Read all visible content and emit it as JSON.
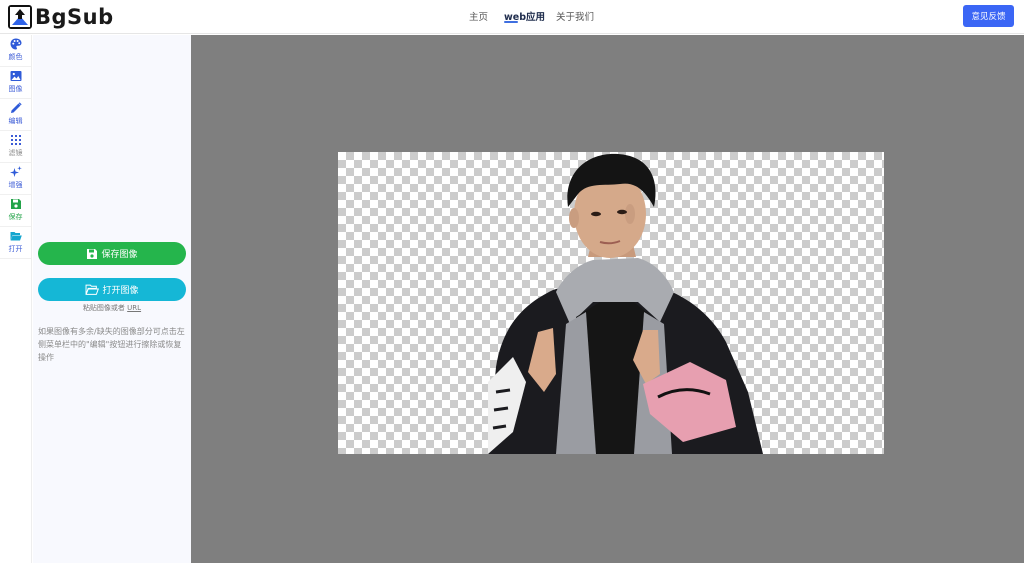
{
  "header": {
    "logo_text": "BgSub",
    "nav": [
      {
        "label": "主页",
        "active": false
      },
      {
        "label": "web应用",
        "active": true
      },
      {
        "label": "关于我们",
        "active": false
      }
    ],
    "feedback_label": "意见反馈",
    "accent_color": "#3b66f5"
  },
  "rail": {
    "items": [
      {
        "label": "颜色",
        "icon": "palette-icon"
      },
      {
        "label": "图像",
        "icon": "image-icon"
      },
      {
        "label": "编辑",
        "icon": "pencil-icon"
      },
      {
        "label": "滤镜",
        "icon": "filter-icon"
      },
      {
        "label": "增强",
        "icon": "sparkle-icon"
      },
      {
        "label": "保存",
        "icon": "floppy-disk-icon"
      },
      {
        "label": "打开",
        "icon": "folder-open-icon"
      }
    ]
  },
  "panel": {
    "save_label": "保存图像",
    "open_label": "打开图像",
    "paste_hint": "粘贴图像或者",
    "paste_url": "URL",
    "note": "如果图像有多余/缺失的图像部分可点击左侧菜单栏中的\"编辑\"按钮进行擦除或恢复操作"
  },
  "canvas": {
    "background": "#7f7f7f",
    "image_subject": "cut-out-person-photo"
  }
}
